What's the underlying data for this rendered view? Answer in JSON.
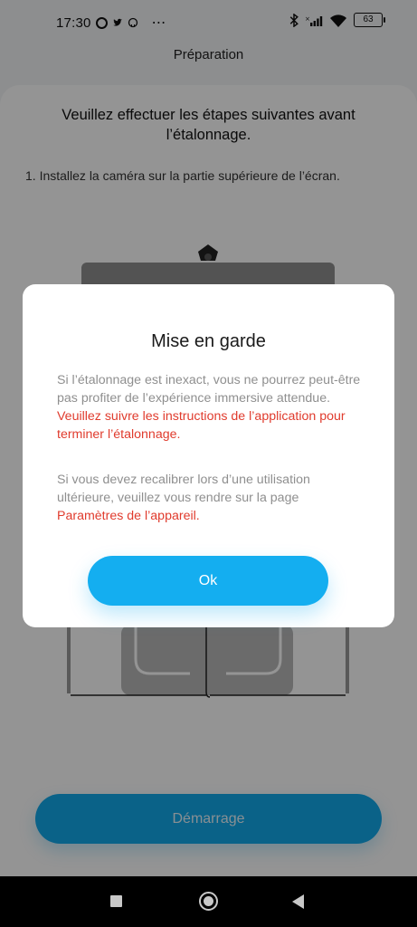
{
  "status_bar": {
    "time": "17:30",
    "dots": "⋯",
    "battery": "63"
  },
  "header": {
    "title": "Préparation"
  },
  "main": {
    "intro": "Veuillez effectuer les étapes suivantes avant l’étalonnage.",
    "step1": "1. Installez la caméra sur la partie supérieure de l’écran.",
    "start_label": "Démarrage"
  },
  "dialog": {
    "title": "Mise en garde",
    "p1_plain": "Si l’étalonnage est inexact, vous ne pourrez peut-être pas profiter de l’expérience immersive attendue. ",
    "p1_highlight": "Veuillez suivre les instructions de l’application pour terminer l’étalonnage",
    "p1_end": ".",
    "p2_plain": "Si vous devez recalibrer lors d’une utilisation ultérieure, veuillez vous rendre sur la page ",
    "p2_highlight": "Paramètres de l’appareil",
    "p2_end": ".",
    "ok_label": "Ok"
  },
  "icons": [
    "ring-icon",
    "twitter-bird-icon",
    "github-icon",
    "bluetooth-icon",
    "signal-icon",
    "wifi-icon",
    "battery-icon",
    "square-nav-icon",
    "home-nav-icon",
    "back-nav-icon"
  ],
  "colors": {
    "accent": "#14aef0",
    "warning_text": "#e03b2d",
    "muted_text": "#8f8f8f"
  }
}
